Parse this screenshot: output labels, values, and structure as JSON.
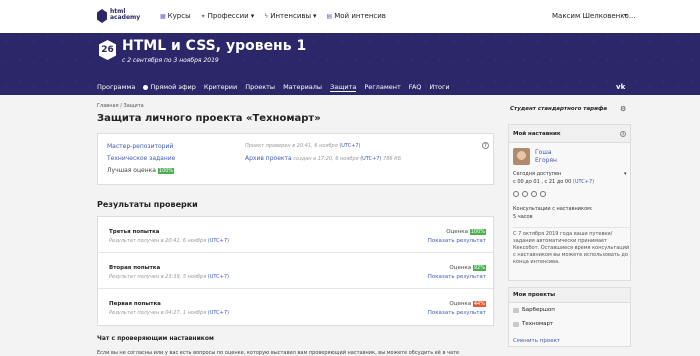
{
  "brand": {
    "logo_text_1": "html",
    "logo_text_2": "academy"
  },
  "topnav": [
    {
      "label": "Курсы",
      "icon": "grid-icon"
    },
    {
      "label": "Профессии",
      "icon": "star-icon"
    },
    {
      "label": "Интенсивы",
      "icon": "bolt-icon"
    },
    {
      "label": "Мой интенсив",
      "icon": "list-icon"
    }
  ],
  "user": {
    "name": "Максим Шелковенко..."
  },
  "hero": {
    "number": "26",
    "title": "HTML и CSS, уровень 1",
    "dates": "с 2 сентября по 3 ноября 2019"
  },
  "subnav": [
    {
      "label": "Программа"
    },
    {
      "label": "Прямой эфир"
    },
    {
      "label": "Критерии"
    },
    {
      "label": "Проекты"
    },
    {
      "label": "Материалы"
    },
    {
      "label": "Защита"
    },
    {
      "label": "Регламент"
    },
    {
      "label": "FAQ"
    },
    {
      "label": "Итоги"
    }
  ],
  "subnav_active": "Защита",
  "breadcrumb": {
    "home": "Главная",
    "current": "Защита"
  },
  "page": {
    "title": "Защита личного проекта «Техномарт»"
  },
  "project": {
    "master_repo": "Мастер-репозиторий",
    "spec": "Техническое задание",
    "best_grade_label": "Лучшая оценка",
    "best_grade": "100%",
    "checked": "Проект проверен в 20:41, 6 ноября",
    "archive": "Архив проекта",
    "archive_meta": "создан в 17:20, 6 ноября",
    "archive_size": "786 КБ",
    "utc": "(UTC+7)"
  },
  "results": {
    "title": "Результаты проверки",
    "show_label": "Показать результат",
    "grade_label": "Оценка",
    "items": [
      {
        "name": "Третья попытка",
        "received": "Результат получен в 20:41, 6 ноября",
        "utc": "(UTC+7)",
        "grade": "100%",
        "color": "#4caf50"
      },
      {
        "name": "Вторая попытка",
        "received": "Результат получен в 23:39, 5 ноября",
        "utc": "(UTC+7)",
        "grade": "92%",
        "color": "#4caf50"
      },
      {
        "name": "Первая попытка",
        "received": "Результат получен в 04:27, 1 ноября",
        "utc": "(UTC+7)",
        "grade": "44%",
        "color": "#e35b3b"
      }
    ]
  },
  "chat": {
    "title": "Чат с проверяющим наставником",
    "text": "Если вы не согласны или у вас есть вопросы по оценке, которую выставил вам проверяющий наставник, вы можете обсудить её в чате"
  },
  "sidebar": {
    "student": "Студент стандартного тарифа",
    "mentor_title": "Мой наставник",
    "mentor_first": "Гоша",
    "mentor_last": "Егорян",
    "available": "Сегодня доступен",
    "available_hours": "с 00 до 01 , с 21 до 00",
    "utc": "(UTC+7)",
    "consult_label": "Консультации с наставником:",
    "consult_value": "5 часов",
    "note": "С 7 октября 2019 года ваши путевки/задания автоматически принимает Кексобот. Оставшиеся время консультаций с наставником вы можете использовать до конца интенсива.",
    "projects_title": "Мои проекты",
    "projects": [
      {
        "name": "Барбершоп"
      },
      {
        "name": "Техномарт"
      }
    ],
    "change_project": "Сменить проект"
  }
}
